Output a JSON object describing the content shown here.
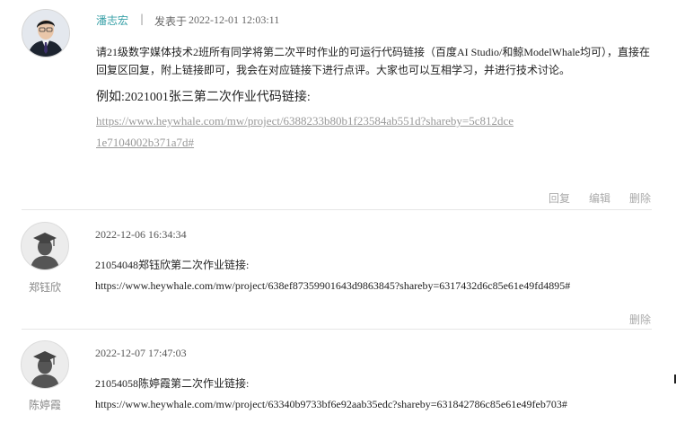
{
  "post": {
    "author": "潘志宏",
    "separator": "|",
    "posted_label": "发表于",
    "posted_time": "2022-12-01 12:03:11",
    "body": "请21级数字媒体技术2班所有同学将第二次平时作业的可运行代码链接（百度AI Studio/和鲸ModelWhale均可），直接在回复区回复，附上链接即可，我会在对应链接下进行点评。大家也可以互相学习，并进行技术讨论。",
    "example": "例如:2021001张三第二次作业代码链接:",
    "link": "https://www.heywhale.com/mw/project/6388233b80b1f23584ab551d?shareby=5c812dce1e7104002b371a7d#",
    "actions": {
      "reply": "回复",
      "edit": "编辑",
      "delete": "删除"
    }
  },
  "replies": [
    {
      "username": "郑钰欣",
      "time": "2022-12-06 16:34:34",
      "text": "21054048郑钰欣第二次作业链接:",
      "link": "https://www.heywhale.com/mw/project/638ef87359901643d9863845?shareby=6317432d6c85e61e49fd4895#",
      "delete": "删除"
    },
    {
      "username": "陈婷霞",
      "time": "2022-12-07 17:47:03",
      "text": "21054058陈婷霞第二次作业链接:",
      "link": "https://www.heywhale.com/mw/project/63340b9733bf6e92aab35edc?shareby=631842786c85e61e49feb703#"
    }
  ],
  "colors": {
    "author": "#3aa1a8",
    "muted": "#aaaaaa",
    "link": "#999999"
  },
  "icons": {
    "main_avatar": "user-photo",
    "default_avatar": "graduate-silhouette-icon"
  }
}
